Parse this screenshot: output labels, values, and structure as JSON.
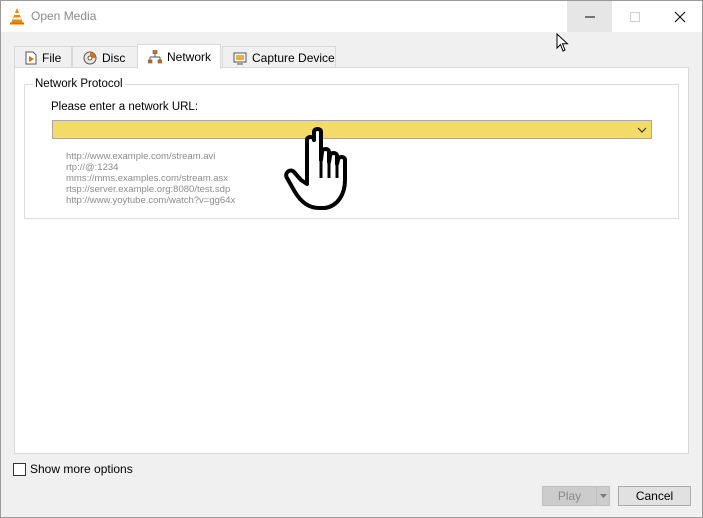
{
  "window": {
    "title": "Open Media",
    "icon": "vlc-cone-icon"
  },
  "tabs": [
    {
      "label": "File",
      "icon": "file-icon",
      "active": false
    },
    {
      "label": "Disc",
      "icon": "disc-icon",
      "active": false
    },
    {
      "label": "Network",
      "icon": "network-icon",
      "active": true
    },
    {
      "label": "Capture Device",
      "icon": "capture-device-icon",
      "active": false
    }
  ],
  "network": {
    "group_title": "Network Protocol",
    "url_label": "Please enter a network URL:",
    "url_value": "",
    "url_highlight_color": "#f2db66",
    "examples": [
      "http://www.example.com/stream.avi",
      "rtp://@:1234",
      "mms://mms.examples.com/stream.asx",
      "rtsp://server.example.org:8080/test.sdp",
      "http://www.yoytube.com/watch?v=gg64x"
    ]
  },
  "footer": {
    "show_more_label": "Show more options",
    "show_more_checked": false,
    "play_label": "Play",
    "cancel_label": "Cancel"
  }
}
